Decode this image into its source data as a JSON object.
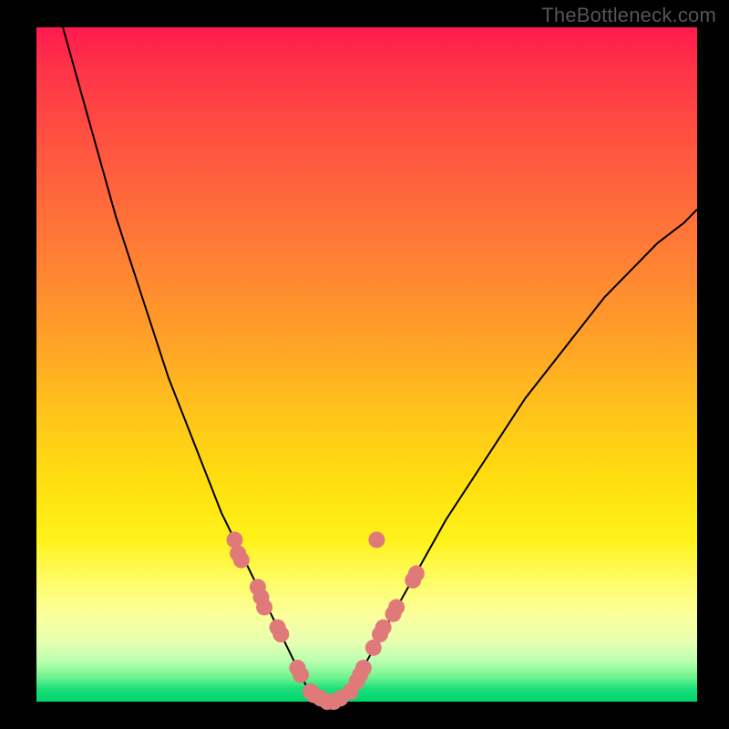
{
  "watermark": "TheBottleneck.com",
  "colors": {
    "marker": "#e07a7a",
    "curve": "#000000",
    "frame": "#000000"
  },
  "chart_data": {
    "type": "line",
    "title": "",
    "xlabel": "",
    "ylabel": "",
    "xlim": [
      0,
      100
    ],
    "ylim": [
      0,
      100
    ],
    "grid": false,
    "series": [
      {
        "name": "left-branch",
        "x": [
          4,
          6,
          8,
          10,
          12,
          14,
          16,
          18,
          20,
          22,
          24,
          26,
          28,
          30,
          32,
          34,
          36,
          38,
          40,
          41,
          42
        ],
        "y": [
          100,
          93,
          86,
          79,
          72,
          66,
          60,
          54,
          48,
          43,
          38,
          33,
          28,
          24,
          20,
          16,
          12,
          8,
          4,
          2,
          1
        ]
      },
      {
        "name": "valley",
        "x": [
          42,
          43,
          44,
          45,
          46,
          47
        ],
        "y": [
          1,
          0.5,
          0,
          0,
          0.5,
          1
        ]
      },
      {
        "name": "right-branch",
        "x": [
          47,
          50,
          54,
          58,
          62,
          66,
          70,
          74,
          78,
          82,
          86,
          90,
          94,
          98,
          100
        ],
        "y": [
          1,
          6,
          13,
          20,
          27,
          33,
          39,
          45,
          50,
          55,
          60,
          64,
          68,
          71,
          73
        ]
      }
    ],
    "markers": {
      "name": "highlighted-points",
      "points": [
        {
          "x": 30,
          "y": 24
        },
        {
          "x": 30.5,
          "y": 22
        },
        {
          "x": 31,
          "y": 21
        },
        {
          "x": 33.5,
          "y": 17
        },
        {
          "x": 34,
          "y": 15.5
        },
        {
          "x": 34.5,
          "y": 14
        },
        {
          "x": 36.5,
          "y": 11
        },
        {
          "x": 37,
          "y": 10
        },
        {
          "x": 39.5,
          "y": 5
        },
        {
          "x": 40,
          "y": 4
        },
        {
          "x": 41.5,
          "y": 1.5
        },
        {
          "x": 42,
          "y": 1
        },
        {
          "x": 43,
          "y": 0.5
        },
        {
          "x": 44,
          "y": 0
        },
        {
          "x": 45,
          "y": 0
        },
        {
          "x": 46,
          "y": 0.5
        },
        {
          "x": 47.5,
          "y": 1.5
        },
        {
          "x": 48.5,
          "y": 3
        },
        {
          "x": 49,
          "y": 4
        },
        {
          "x": 49.5,
          "y": 5
        },
        {
          "x": 51,
          "y": 8
        },
        {
          "x": 52,
          "y": 10
        },
        {
          "x": 52.5,
          "y": 11
        },
        {
          "x": 54,
          "y": 13
        },
        {
          "x": 54.5,
          "y": 14
        },
        {
          "x": 57,
          "y": 18
        },
        {
          "x": 57.5,
          "y": 19
        },
        {
          "x": 51.5,
          "y": 24
        }
      ]
    }
  }
}
